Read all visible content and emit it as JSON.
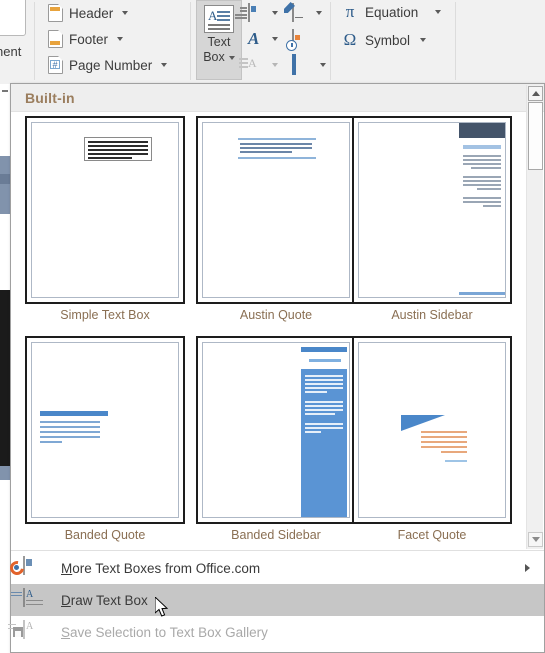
{
  "ribbon": {
    "left_group_label": "nent",
    "items": [
      {
        "label": "Header",
        "icon": "header-page-icon",
        "has_caret": true
      },
      {
        "label": "Footer",
        "icon": "footer-page-icon",
        "has_caret": true
      },
      {
        "label": "Page Number",
        "icon": "page-number-icon",
        "has_caret": true
      }
    ],
    "text_box_button": {
      "line1": "Text",
      "line2": "Box",
      "icon": "text-box-icon",
      "active": true
    },
    "mini_buttons": [
      {
        "name": "quick-parts-icon",
        "has_caret": true,
        "enabled": true
      },
      {
        "name": "signature-line-icon",
        "has_caret": true,
        "enabled": true
      },
      {
        "name": "wordart-icon",
        "glyph": "A",
        "has_caret": true,
        "enabled": true
      },
      {
        "name": "date-and-time-icon",
        "has_caret": false,
        "enabled": true
      },
      {
        "name": "drop-cap-icon",
        "has_caret": true,
        "enabled": false
      },
      {
        "name": "object-icon",
        "has_caret": true,
        "enabled": true
      }
    ],
    "symbols_group": [
      {
        "label": "Equation",
        "glyph": "π",
        "has_caret": true
      },
      {
        "label": "Symbol",
        "glyph": "Ω",
        "has_caret": true
      }
    ]
  },
  "gallery": {
    "header": "Built-in",
    "items": [
      {
        "label": "Simple Text Box",
        "style": "simple"
      },
      {
        "label": "Austin Quote",
        "style": "austin-quote"
      },
      {
        "label": "Austin Sidebar",
        "style": "austin-sidebar"
      },
      {
        "label": "Banded Quote",
        "style": "banded-quote"
      },
      {
        "label": "Banded Sidebar",
        "style": "banded-sidebar"
      },
      {
        "label": "Facet Quote",
        "style": "facet-quote"
      }
    ],
    "scrollbar": {
      "up_arrow": "▲",
      "down_arrow": "▼"
    }
  },
  "menu": {
    "items": [
      {
        "label": "More Text Boxes from Office.com",
        "accel": "M",
        "icon": "office-online-icon",
        "submenu_arrow": true,
        "enabled": true,
        "highlighted": false
      },
      {
        "label": "Draw Text Box",
        "accel": "D",
        "icon": "draw-text-box-icon",
        "submenu_arrow": false,
        "enabled": true,
        "highlighted": true
      },
      {
        "label": "Save Selection to Text Box Gallery",
        "accel": "S",
        "icon": "save-text-box-icon",
        "submenu_arrow": false,
        "enabled": false,
        "highlighted": false
      }
    ]
  },
  "colors": {
    "accent_blue": "#4a87c9",
    "navy": "#44546a",
    "gallery_header_text": "#9b7e5e",
    "label_text": "#8a6f53",
    "highlight": "#c6c6c6",
    "ribbon_bg": "#f1f1f1"
  }
}
